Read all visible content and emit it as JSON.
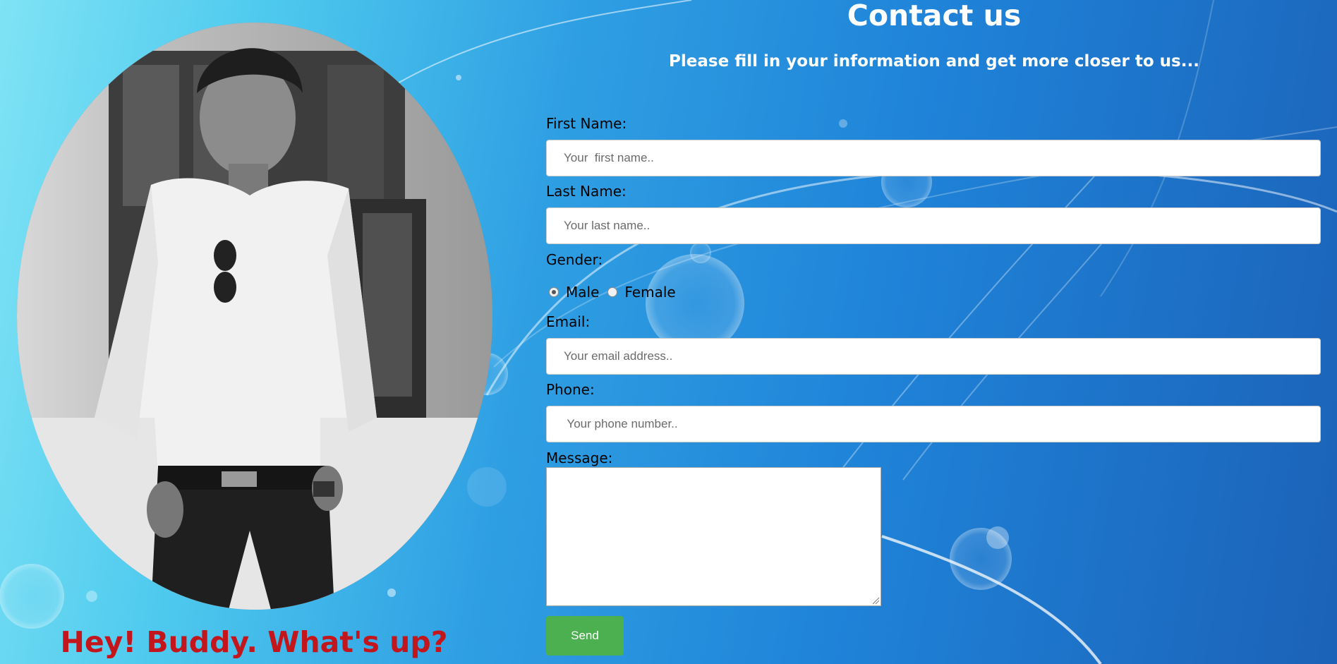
{
  "page": {
    "tagline": "Hey! Buddy. What's up?",
    "photo_alt": "Portrait photo",
    "accent_color": "#c3161c",
    "button_color": "#4caf50"
  },
  "contact": {
    "title": "Contact us",
    "subtitle": "Please fill in your information and get more closer to us...",
    "first_name": {
      "label": "First Name:",
      "placeholder": "Your  first name.."
    },
    "last_name": {
      "label": "Last Name:",
      "placeholder": "Your last name.."
    },
    "gender": {
      "label": "Gender:",
      "options": [
        "Male",
        "Female"
      ],
      "selected": "Male"
    },
    "email": {
      "label": "Email:",
      "placeholder": "Your email address.."
    },
    "phone": {
      "label": "Phone:",
      "placeholder": " Your phone number.."
    },
    "message": {
      "label": "Message:",
      "value": ""
    },
    "send_label": "Send"
  }
}
